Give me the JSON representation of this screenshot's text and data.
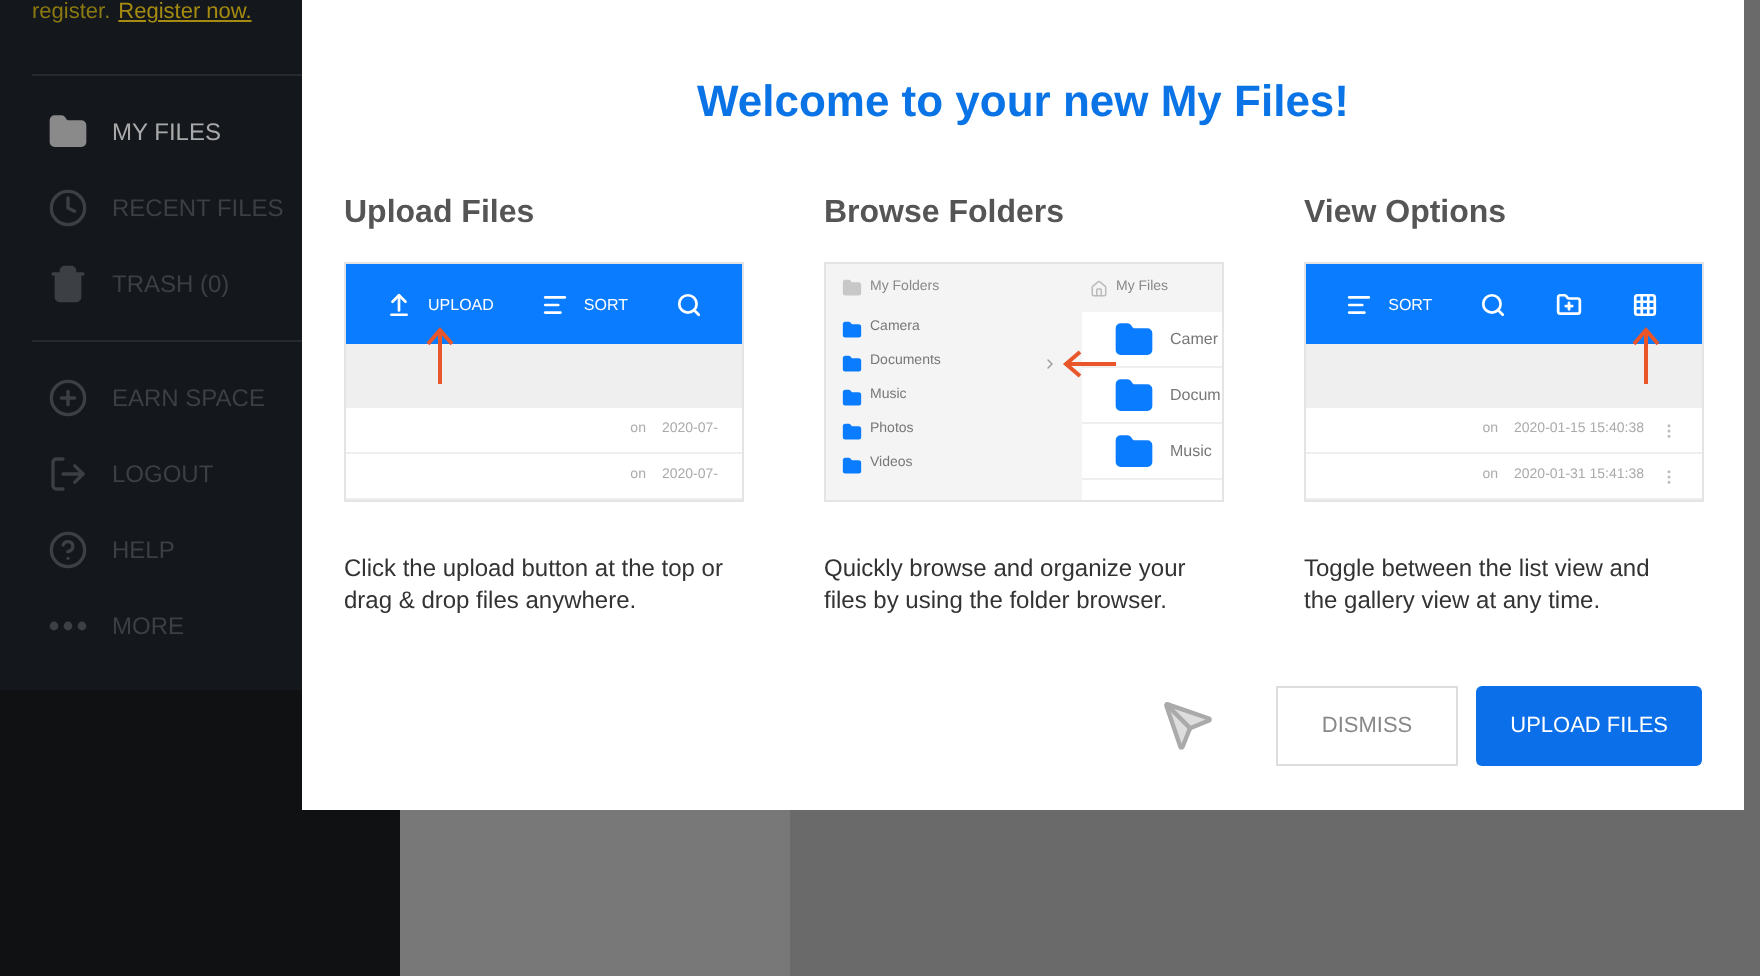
{
  "sidebar": {
    "register_prompt": "register.",
    "register_link": "Register now.",
    "groups": [
      [
        {
          "kind": "folder",
          "label": "MY FILES",
          "selected": true
        },
        {
          "kind": "clock",
          "label": "RECENT FILES",
          "selected": false
        },
        {
          "kind": "trash",
          "label": "TRASH (0)",
          "selected": false
        }
      ],
      [
        {
          "kind": "plus",
          "label": "EARN SPACE",
          "selected": false
        },
        {
          "kind": "logout",
          "label": "LOGOUT",
          "selected": false
        },
        {
          "kind": "help",
          "label": "HELP",
          "selected": false
        },
        {
          "kind": "more",
          "label": "MORE",
          "selected": false
        }
      ]
    ]
  },
  "dialog": {
    "title": "Welcome to your new My Files!",
    "cards": [
      {
        "title": "Upload Files",
        "kind": "toolbar",
        "toolbar": [
          {
            "kind": "upload",
            "label": "UPLOAD",
            "pointed": true
          },
          {
            "kind": "sort",
            "label": "SORT",
            "pointed": false
          },
          {
            "kind": "search",
            "pointed": false
          }
        ],
        "rows": [
          {
            "owner": "on",
            "date": "2020-07-"
          },
          {
            "owner": "on",
            "date": "2020-07-"
          }
        ],
        "description": "Click the upload button at the top or drag & drop files anywhere."
      },
      {
        "title": "Browse Folders",
        "kind": "browser",
        "left_header": "My Folders",
        "right_header": "My Files",
        "folders": [
          {
            "label": "Camera",
            "pointed": false
          },
          {
            "label": "Documents",
            "pointed": true
          },
          {
            "label": "Music",
            "pointed": false
          },
          {
            "label": "Photos",
            "pointed": false
          },
          {
            "label": "Videos",
            "pointed": false
          }
        ],
        "files": [
          "Camer",
          "Docum",
          "Music"
        ],
        "description": "Quickly browse and organize your files by using the folder browser."
      },
      {
        "title": "View Options",
        "kind": "toolbar",
        "toolbar": [
          {
            "kind": "sort",
            "label": "SORT",
            "pointed": false
          },
          {
            "kind": "search",
            "pointed": false
          },
          {
            "kind": "folder-plus",
            "pointed": false
          },
          {
            "kind": "grid",
            "pointed": true
          }
        ],
        "rows": [
          {
            "owner": "on",
            "date": "2020-01-15 15:40:38"
          },
          {
            "owner": "on",
            "date": "2020-01-31 15:41:38"
          }
        ],
        "description": "Toggle between the list view and the gallery view at any time."
      }
    ],
    "buttons": [
      {
        "label": "DISMISS",
        "kind": "secondary"
      },
      {
        "label": "UPLOAD FILES",
        "kind": "primary"
      }
    ]
  }
}
